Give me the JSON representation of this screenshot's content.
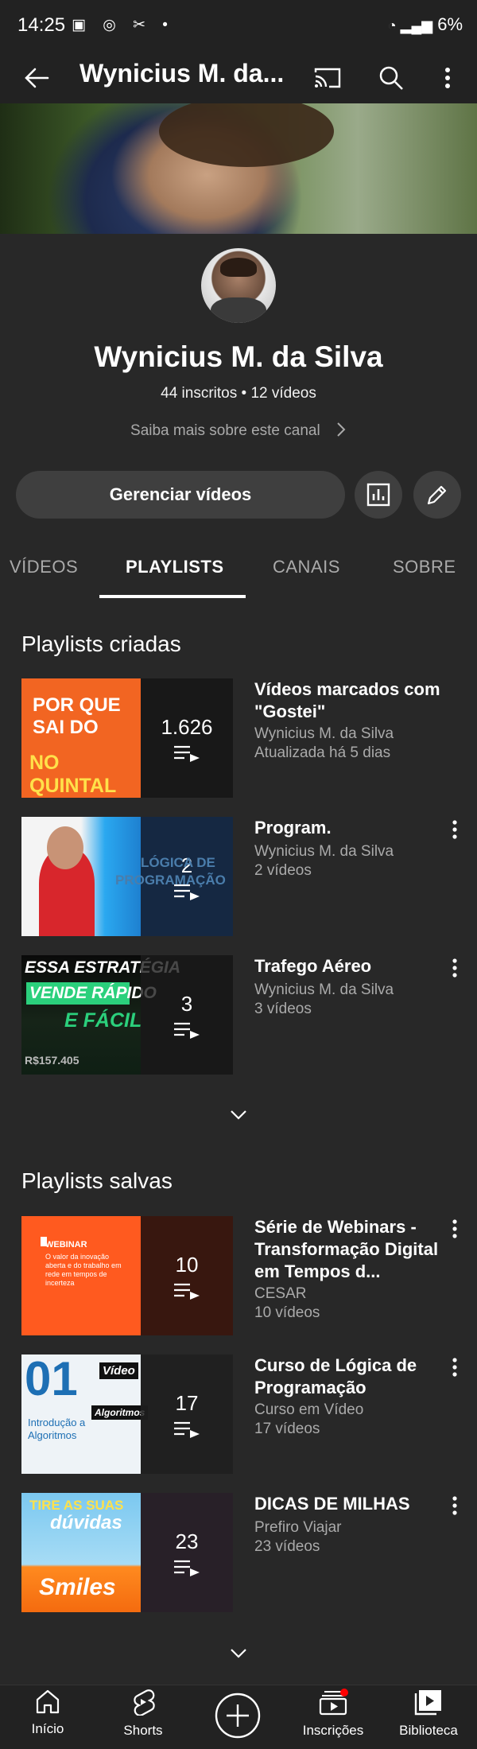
{
  "status_bar": {
    "time": "14:25",
    "battery": "6%"
  },
  "app_bar": {
    "title": "Wynicius M. da..."
  },
  "channel": {
    "name": "Wynicius M. da Silva",
    "stats": "44 inscritos • 12 vídeos",
    "learn_more": "Saiba mais sobre este canal"
  },
  "actions": {
    "manage_label": "Gerenciar vídeos"
  },
  "tabs": [
    {
      "label": "VÍDEOS"
    },
    {
      "label": "PLAYLISTS"
    },
    {
      "label": "CANAIS"
    },
    {
      "label": "SOBRE"
    }
  ],
  "created": {
    "heading": "Playlists criadas",
    "items": [
      {
        "title": "Vídeos marcados com \"Gostei\"",
        "meta1": "Wynicius M. da Silva",
        "meta2": "Atualizada há 5 dias",
        "count": "1.626",
        "thumb_text": [
          "POR QUE",
          "SAI DO",
          "NO QUINTAL"
        ]
      },
      {
        "title": "Program.",
        "meta1": "Wynicius M. da Silva",
        "meta2": "2 vídeos",
        "count": "2",
        "thumb_text": [
          "LÓGICA DE",
          "PROGRAMAÇÃO"
        ]
      },
      {
        "title": "Trafego Aéreo",
        "meta1": "Wynicius M. da Silva",
        "meta2": "3 vídeos",
        "count": "3",
        "thumb_text": [
          "ESSA ESTRATÉGIA",
          "VENDE RÁPIDO",
          "E FÁCIL",
          "R$157.405"
        ]
      }
    ]
  },
  "saved": {
    "heading": "Playlists salvas",
    "items": [
      {
        "title": "Série de Webinars - Transformação Digital em Tempos d...",
        "meta1": "CESAR",
        "meta2": "10 vídeos",
        "count": "10",
        "thumb_text": [
          "WEBINAR",
          "O valor da inovação aberta e do trabalho em rede em tempos de incerteza"
        ]
      },
      {
        "title": "Curso de Lógica de Programação",
        "meta1": "Curso em Vídeo",
        "meta2": "17 vídeos",
        "count": "17",
        "thumb_text": [
          "01",
          "Vídeo",
          "Algoritmos",
          "Introdução a Algoritmos"
        ]
      },
      {
        "title": "DICAS DE MILHAS",
        "meta1": "Prefiro Viajar",
        "meta2": "23 vídeos",
        "count": "23",
        "thumb_text": [
          "TIRE AS SUAS",
          "dúvidas",
          "Smiles"
        ]
      }
    ]
  },
  "bottom_nav": [
    {
      "label": "Início",
      "icon": "home-icon"
    },
    {
      "label": "Shorts",
      "icon": "shorts-icon"
    },
    {
      "label": "",
      "icon": "create-icon"
    },
    {
      "label": "Inscrições",
      "icon": "subscriptions-icon"
    },
    {
      "label": "Biblioteca",
      "icon": "library-icon"
    }
  ],
  "colors": {
    "background": "#282828",
    "bar": "#222222",
    "button": "#3f3f3f",
    "notification": "#ff0000"
  }
}
